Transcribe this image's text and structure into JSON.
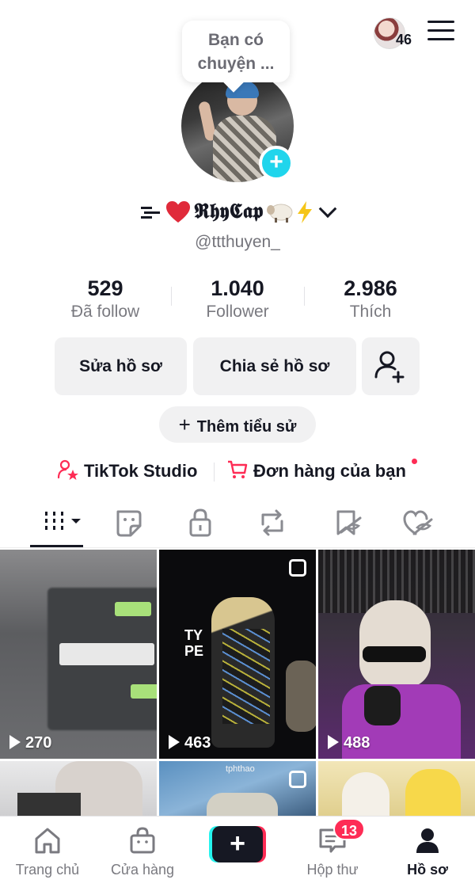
{
  "header": {
    "notification_count": "46"
  },
  "profile": {
    "note_bubble": "Bạn có chuyện ...",
    "display_name": "𝕽𝖍𝖞𝕮𝖆𝖕",
    "username": "@ttthuyen_"
  },
  "stats": [
    {
      "value": "529",
      "label": "Đã follow"
    },
    {
      "value": "1.040",
      "label": "Follower"
    },
    {
      "value": "2.986",
      "label": "Thích"
    }
  ],
  "actions": {
    "edit_profile": "Sửa hồ sơ",
    "share_profile": "Chia sẻ hồ sơ",
    "add_bio": "Thêm tiểu sử"
  },
  "links": {
    "studio": "TikTok Studio",
    "orders": "Đơn hàng của bạn"
  },
  "tabs": [
    "videos-grid-icon",
    "stickers-icon",
    "private-lock-icon",
    "repost-icon",
    "favorites-icon",
    "liked-icon"
  ],
  "videos": [
    {
      "views": "270"
    },
    {
      "views": "463",
      "overlay_text": "TY PE"
    },
    {
      "views": "488"
    },
    {},
    {
      "overlay_text": "tphthao"
    },
    {}
  ],
  "bottom_nav": {
    "home": "Trang chủ",
    "shop": "Cửa hàng",
    "inbox": "Hộp thư",
    "inbox_badge": "13",
    "profile": "Hồ sơ"
  },
  "colors": {
    "accent_pink": "#fe2c55",
    "accent_cyan": "#25f4ee",
    "avatar_add": "#20d5ec",
    "text_primary": "#161823",
    "text_secondary": "#7a7a80",
    "button_bg": "#f1f1f2"
  }
}
